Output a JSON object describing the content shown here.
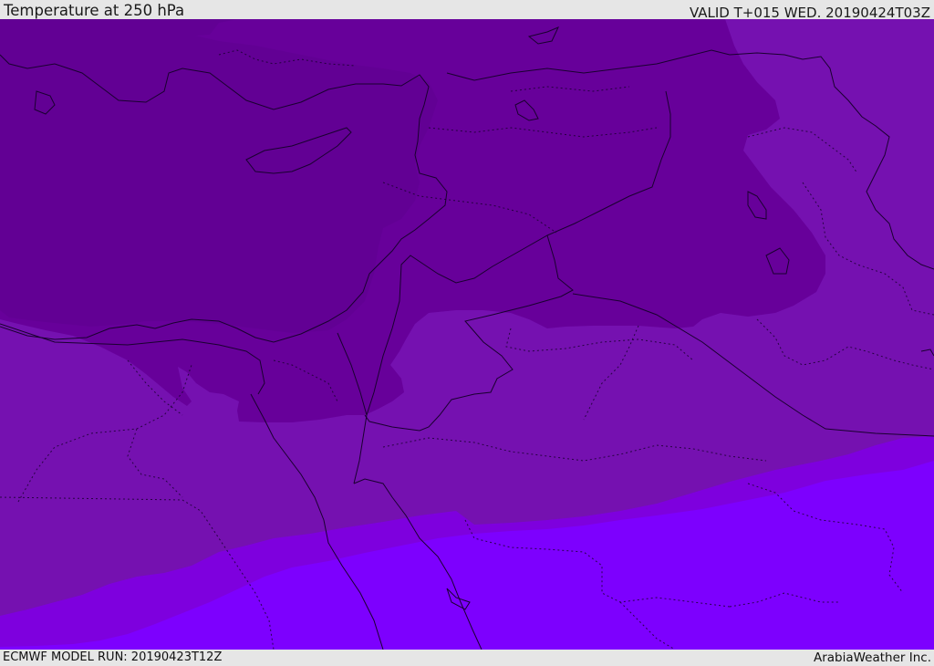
{
  "header": {
    "title": "Temperature at 250 hPa",
    "valid_time": "VALID T+015 WED. 20190424T03Z"
  },
  "footer": {
    "model_run": "ECMWF MODEL RUN: 20190423T12Z",
    "credit": "ArabiaWeather Inc."
  },
  "map": {
    "temperature_band_colors": [
      "#5f0090",
      "#67009a",
      "#7511b0",
      "#7e00de",
      "#7d00fe"
    ]
  }
}
